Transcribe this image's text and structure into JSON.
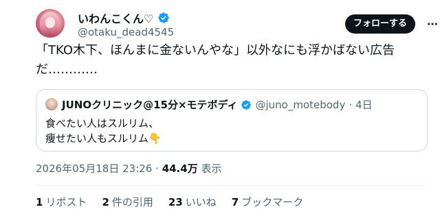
{
  "author": {
    "display_name": "いわんこくん♡",
    "handle": "@otaku_dead4545",
    "verified_icon": "verified-badge-icon"
  },
  "follow_button_label": "フォローする",
  "tweet_text": "「TKO木下、ほんまに金ないんやな」以外なにも浮かばない広告だ…………",
  "quote": {
    "display_name": "JUNOクリニック@15分×モテボディ",
    "handle": "@juno_motebody",
    "separator": "·",
    "time": "4日",
    "text": "食べたい人はスルリム、\n痩せたい人もスルリム👇"
  },
  "meta": {
    "timestamp": "2026年05月18日 23:26",
    "separator": "·",
    "views_count": "44.4万",
    "views_label": "表示"
  },
  "stats": [
    {
      "count": "1",
      "label": "リポスト"
    },
    {
      "count": "2",
      "label": "件の引用"
    },
    {
      "count": "23",
      "label": "いいね"
    },
    {
      "count": "7",
      "label": "ブックマーク"
    }
  ],
  "colors": {
    "text_primary": "#0f1419",
    "text_secondary": "#536471",
    "verified_blue": "#1d9bf0",
    "border": "#cfd9de"
  }
}
